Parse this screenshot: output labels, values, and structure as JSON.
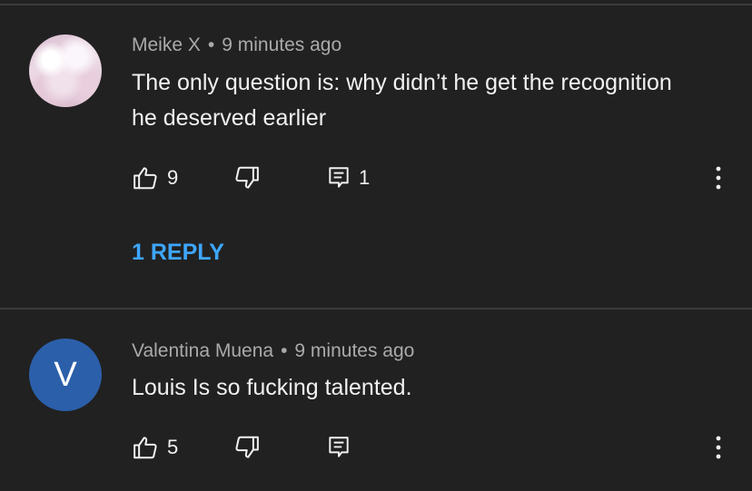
{
  "comments": [
    {
      "author": "Meike X",
      "separator": "•",
      "time": "9 minutes ago",
      "text": "The only question is: why didn’t he get the recognition he deserved earlier",
      "likes": "9",
      "reply_count": "1",
      "replies_link": "1 REPLY",
      "avatar": {
        "type": "image",
        "description_icon": "cloud-avatar-icon"
      }
    },
    {
      "author": "Valentina Muena",
      "separator": "•",
      "time": "9 minutes ago",
      "text": "Louis Is so fucking talented.",
      "likes": "5",
      "avatar": {
        "type": "letter",
        "letter": "V",
        "color": "#2b5fa9"
      }
    }
  ],
  "icons": {
    "like": "thumbs-up-icon",
    "dislike": "thumbs-down-icon",
    "reply": "comment-icon",
    "more": "more-vertical-icon"
  },
  "colors": {
    "background": "#212121",
    "primary_text": "#f1f1f1",
    "secondary_text": "#aaaaaa",
    "link": "#3ea6ff",
    "divider": "#3a3a3a"
  }
}
